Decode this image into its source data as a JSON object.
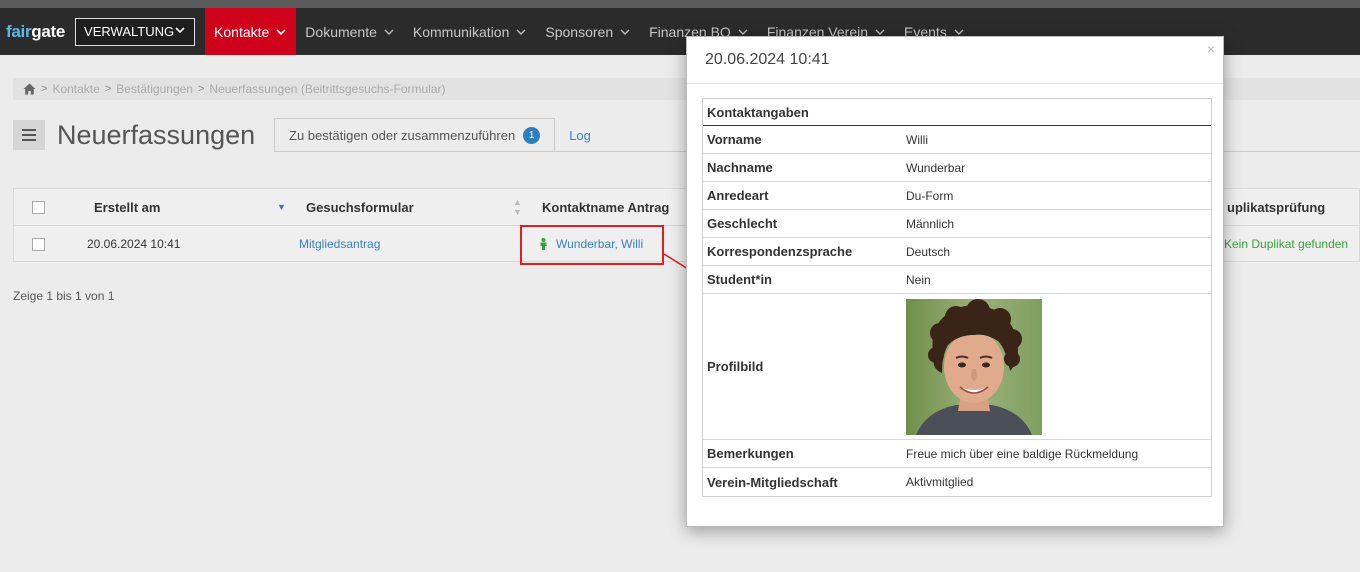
{
  "app": {
    "logo_fair": "fair",
    "logo_gate": "gate",
    "area_select": "VERWALTUNG"
  },
  "nav": {
    "items": [
      {
        "label": "Kontakte",
        "active": true
      },
      {
        "label": "Dokumente"
      },
      {
        "label": "Kommunikation"
      },
      {
        "label": "Sponsoren"
      },
      {
        "label": "Finanzen BO"
      },
      {
        "label": "Finanzen Verein"
      },
      {
        "label": "Events"
      }
    ]
  },
  "breadcrumb": {
    "items": [
      "Kontakte",
      "Bestätigungen",
      "Neuerfassungen (Beitrittsgesuchs-Formular)"
    ]
  },
  "page": {
    "title": "Neuerfassungen"
  },
  "tabs": [
    {
      "label": "Zu bestätigen oder zusammenzuführen",
      "badge": "1"
    },
    {
      "label": "Log"
    }
  ],
  "table": {
    "columns": [
      "Erstellt am",
      "Gesuchsformular",
      "Kontaktname Antrag",
      "uplikatsprüfung"
    ],
    "rows": [
      {
        "created": "20.06.2024 10:41",
        "form": "Mitgliedsantrag",
        "contact": "Wunderbar, Willi",
        "duplicate": "Kein Duplikat gefunden"
      }
    ],
    "footer": "Zeige 1 bis 1 von 1"
  },
  "modal": {
    "title": "20.06.2024 10:41",
    "close": "×",
    "section": "Kontaktangaben",
    "fields": [
      {
        "key": "Vorname",
        "value": "Willi"
      },
      {
        "key": "Nachname",
        "value": "Wunderbar"
      },
      {
        "key": "Anredeart",
        "value": "Du-Form"
      },
      {
        "key": "Geschlecht",
        "value": "Männlich"
      },
      {
        "key": "Korrespondenzsprache",
        "value": "Deutsch"
      },
      {
        "key": "Student*in",
        "value": "Nein"
      }
    ],
    "photo_label": "Profilbild",
    "fields_after": [
      {
        "key": "Bemerkungen",
        "value": "Freue mich über eine baldige Rückmeldung"
      },
      {
        "key": "Verein-Mitgliedschaft",
        "value": "Aktivmitglied"
      }
    ]
  },
  "colors": {
    "nav_bg": "#2b2b2b",
    "nav_active": "#d0021b",
    "link": "#3b7fc4",
    "success": "#3aa23a",
    "badge": "#2d7fc0",
    "annotation": "#e02020"
  }
}
